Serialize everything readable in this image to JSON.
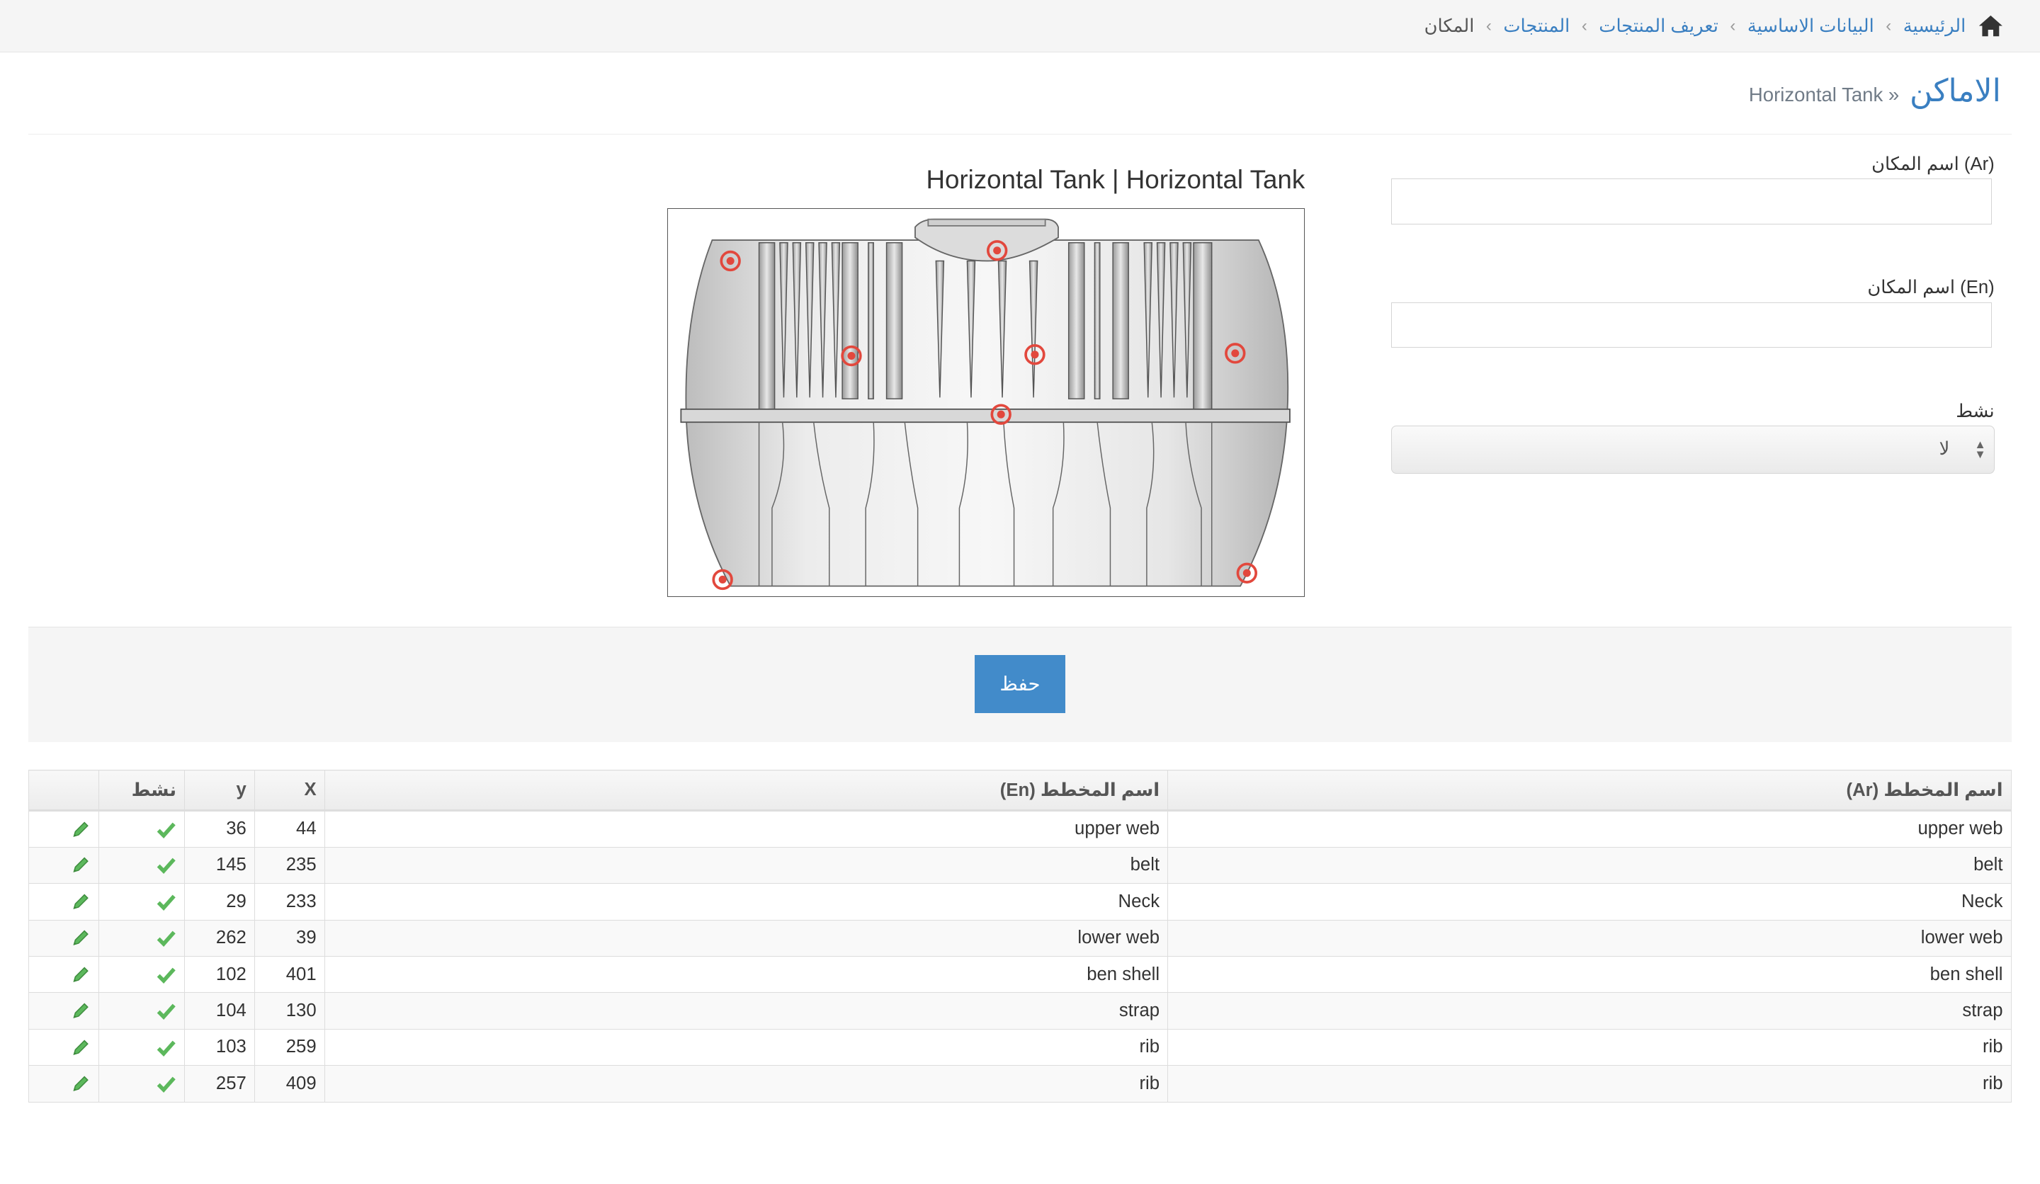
{
  "breadcrumb": {
    "home": "الرئيسية",
    "basic_data": "البيانات الاساسية",
    "product_definition": "تعريف المنتجات",
    "products": "المنتجات",
    "current": "المكان"
  },
  "header": {
    "title": "الاماكن",
    "subtitle": "Horizontal Tank »"
  },
  "form": {
    "name_ar_label": "اسم المكان (Ar)",
    "name_ar_value": "",
    "name_en_label": "اسم المكان (En)",
    "name_en_value": "",
    "active_label": "نشط",
    "active_value": "لا"
  },
  "diagram": {
    "title": "Horizontal Tank | Horizontal Tank"
  },
  "actions": {
    "save_label": "حفظ"
  },
  "table": {
    "headers": {
      "name_ar": "اسم المخطط (Ar)",
      "name_en": "اسم المخطط (En)",
      "x": "X",
      "y": "y",
      "active": "نشط",
      "edit": ""
    },
    "rows": [
      {
        "name_ar": "upper web",
        "name_en": "upper web",
        "x": "44",
        "y": "36"
      },
      {
        "name_ar": "belt",
        "name_en": "belt",
        "x": "235",
        "y": "145"
      },
      {
        "name_ar": "Neck",
        "name_en": "Neck",
        "x": "233",
        "y": "29"
      },
      {
        "name_ar": "lower web",
        "name_en": "lower web",
        "x": "39",
        "y": "262"
      },
      {
        "name_ar": "ben shell",
        "name_en": "ben shell",
        "x": "401",
        "y": "102"
      },
      {
        "name_ar": "strap",
        "name_en": "strap",
        "x": "130",
        "y": "104"
      },
      {
        "name_ar": "rib",
        "name_en": "rib",
        "x": "259",
        "y": "103"
      },
      {
        "name_ar": "rib",
        "name_en": "rib",
        "x": "409",
        "y": "257"
      }
    ]
  },
  "icons": {
    "home": "home-icon",
    "check": "check-icon",
    "edit": "pencil-icon"
  },
  "colors": {
    "link": "#3a7fc1",
    "primary_button": "#428bca",
    "marker": "#d9534f",
    "check": "#5cb85c",
    "pencil": "#5cb85c"
  }
}
